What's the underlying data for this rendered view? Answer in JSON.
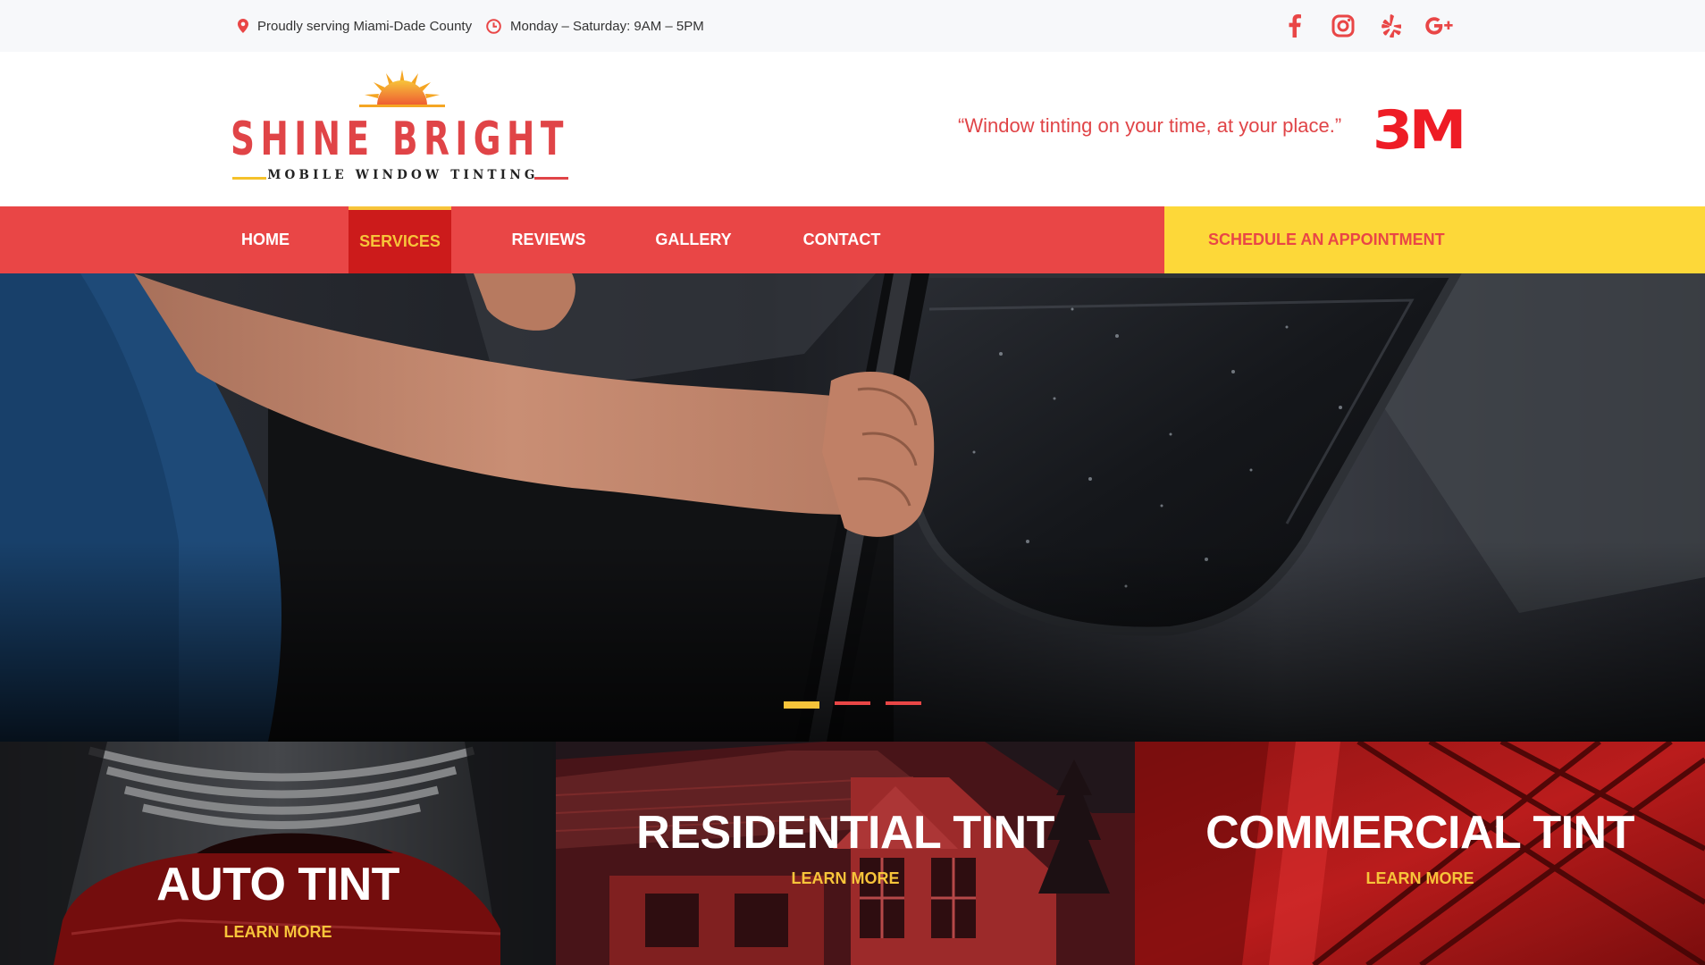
{
  "topbar": {
    "location_icon": "map-pin-icon",
    "location_text": "Proudly serving Miami-Dade County",
    "hours_icon": "clock-icon",
    "hours_text": "Monday – Saturday: 9AM – 5PM",
    "social": [
      {
        "name": "facebook-icon",
        "glyph": "f"
      },
      {
        "name": "instagram-icon",
        "glyph": ""
      },
      {
        "name": "yelp-icon",
        "glyph": ""
      },
      {
        "name": "google-plus-icon",
        "glyph": "G+"
      }
    ]
  },
  "header": {
    "logo_title": "SHINE BRIGHT",
    "logo_subtitle": "MOBILE WINDOW TINTING",
    "logo_icon": "sun-icon",
    "tagline": "“Window tinting on your time, at your place.”",
    "partner_logo": "3M"
  },
  "nav": {
    "items": [
      {
        "label": "HOME",
        "active": false
      },
      {
        "label": "SERVICES",
        "active": true
      },
      {
        "label": "REVIEWS",
        "active": false
      },
      {
        "label": "GALLERY",
        "active": false
      },
      {
        "label": "CONTACT",
        "active": false
      }
    ],
    "cta": "SCHEDULE AN APPOINTMENT"
  },
  "slider": {
    "slides": 3,
    "active_index": 0
  },
  "tiles": [
    {
      "title": "AUTO TINT",
      "link": "LEARN MORE"
    },
    {
      "title": "RESIDENTIAL TINT",
      "link": "LEARN MORE"
    },
    {
      "title": "COMMERCIAL TINT",
      "link": "LEARN MORE"
    }
  ],
  "colors": {
    "brand_red": "#e94646",
    "active_red": "#cc1b1b",
    "accent_yellow": "#f7c43a",
    "cta_yellow": "#fdd839",
    "topbar_bg": "#f7f8fa"
  }
}
